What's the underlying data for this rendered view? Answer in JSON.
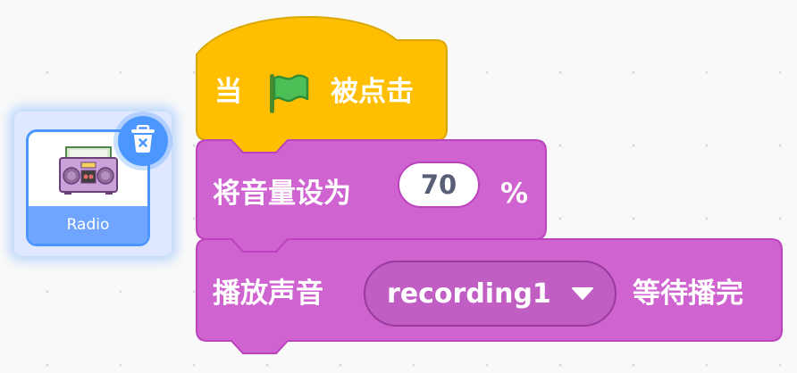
{
  "sprite": {
    "name": "Radio",
    "thumbnail_icon": "boombox-radio-icon",
    "delete_icon": "trash-icon",
    "selected": true
  },
  "blocks": [
    {
      "category": "events",
      "color": "#ffbf00",
      "label_before": "当",
      "icon": "green-flag-icon",
      "label_after": "被点击"
    },
    {
      "category": "sound",
      "color": "#cf63cf",
      "label": "将音量设为",
      "input_value": "70",
      "suffix": "%"
    },
    {
      "category": "sound",
      "color": "#cf63cf",
      "label": "播放声音",
      "dropdown_value": "recording1",
      "dropdown_icon": "caret-down-icon",
      "suffix": "等待播完"
    }
  ],
  "colors": {
    "events": "#ffbf00",
    "sound": "#cf63cf",
    "sound_border": "#bd42bd",
    "selection": "#4c97ff"
  }
}
